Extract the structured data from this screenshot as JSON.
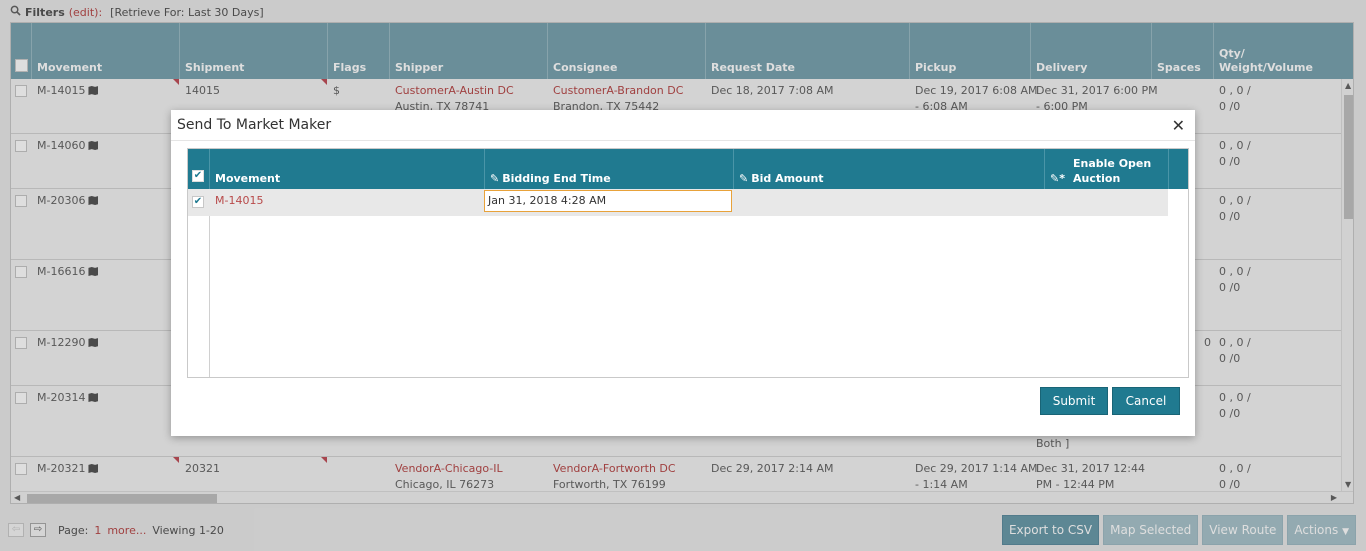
{
  "filters": {
    "label": "Filters",
    "edit": "(edit):",
    "retrieve": "[Retrieve For: Last 30 Days]"
  },
  "grid": {
    "columns": [
      "Movement",
      "Shipment",
      "Flags",
      "Shipper",
      "Consignee",
      "Request Date",
      "Pickup",
      "Delivery",
      "Spaces",
      "Qty/",
      "Weight/Volume"
    ],
    "rows": [
      {
        "movement": "M-14015",
        "shipment": "14015",
        "flag": "$",
        "shipper": "CustomerA-Austin DC",
        "shipper_loc": "Austin, TX 78741",
        "consignee": "CustomerA-Brandon DC",
        "consignee_loc": "Brandon, TX 75442",
        "request": "Dec 18, 2017 7:08 AM",
        "pickup1": "Dec 19, 2017 6:08 AM",
        "pickup2": "- 6:08 AM",
        "delivery1": "Dec 31, 2017 6:00 PM",
        "delivery2": "- 6:00 PM",
        "spaces": "",
        "qty1": "0 , 0 /",
        "qty2": "0 /0"
      },
      {
        "movement": "M-14060",
        "spaces": "",
        "qty1": "0 , 0 /",
        "qty2": "0 /0"
      },
      {
        "movement": "M-20306",
        "spaces": "",
        "qty1": "0 , 0 /",
        "qty2": "0 /0"
      },
      {
        "movement": "M-16616",
        "spaces": "",
        "qty1": "0 , 0 /",
        "qty2": "0 /0"
      },
      {
        "movement": "M-12290",
        "spaces": "0",
        "qty1": "0 , 0 /",
        "qty2": "0 /0"
      },
      {
        "movement": "M-20314",
        "delivery_extra": "Both ]",
        "spaces": "",
        "qty1": "0 , 0 /",
        "qty2": "0 /0"
      },
      {
        "movement": "M-20321",
        "shipment": "20321",
        "shipper": "VendorA-Chicago-IL",
        "shipper_loc": "Chicago, IL 76273",
        "consignee": "VendorA-Fortworth DC",
        "consignee_loc": "Fortworth, TX 76199",
        "request": "Dec 29, 2017 2:14 AM",
        "pickup1": "Dec 29, 2017 1:14 AM",
        "pickup2": "- 1:14 AM",
        "delivery1": "Dec 31, 2017 12:44",
        "delivery2": "PM - 12:44 PM",
        "qty1": "0 , 0 /",
        "qty2": "0 /0"
      }
    ]
  },
  "pager": {
    "page_label": "Page:",
    "page": "1",
    "more": "more...",
    "viewing": "Viewing 1-20"
  },
  "actions": {
    "export": "Export to CSV",
    "map": "Map Selected",
    "route": "View Route",
    "actions": "Actions"
  },
  "modal": {
    "title": "Send To Market Maker",
    "columns": {
      "movement": "Movement",
      "bidding": "Bidding End Time",
      "bid": "Bid Amount",
      "open1": "Enable Open",
      "open2": "Auction"
    },
    "row": {
      "movement": "M-14015",
      "bidding_end": "Jan 31, 2018 4:28 AM",
      "bid_amount": "",
      "checked": true
    },
    "submit": "Submit",
    "cancel": "Cancel"
  },
  "colors": {
    "header_bg": "#7aa4b0",
    "modal_header_bg": "#207a90",
    "link_red": "#b84a4a",
    "focus_border": "#e8a23a"
  }
}
